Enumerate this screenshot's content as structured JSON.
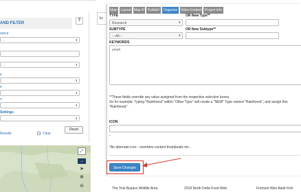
{
  "left_panel": {
    "title": "AND FILTER",
    "help": "?",
    "source_label": "ource",
    "source_value": "...",
    "select2_value": "...",
    "row3_label": "e",
    "row4_label": "e",
    "row5_label": "n",
    "settings_label": "Settings",
    "results_label": "Results",
    "clear_label": "Clear",
    "reset_label": "Reset"
  },
  "modal": {
    "tabs": [
      "Main",
      "Layout",
      "Map It!",
      "Publish!",
      "Organize",
      "Video Embed",
      "Project Info"
    ],
    "active_tab": "Organize",
    "type_label": "TYPE",
    "type_value": "Research",
    "new_type_label": "OR New Type**",
    "subtype_label": "SUBTYPE",
    "subtype_value": "---All---",
    "new_subtype_label": "OR New Subtype**",
    "keywords_label": "KEYWORDS",
    "keywords_value": "smelt",
    "note1": "**These fields override any value assigned from the respective selection boxes.",
    "note2": "So for example: Typing \"Rainforest\" within \"Other Type\" will create a \"NEW\" Type named \"Rainforest\", and assign this",
    "note3": "\"Rainforest\".",
    "icon_label": "ICON",
    "icon_dash": "-",
    "icon_note": "*An alternate icon - overrides content thumbnails etc..",
    "save_label": "Save Changes"
  },
  "background": {
    "back_tab": "Se",
    "card1": "The Yolo Bypass Wildlife Area",
    "card2": "2018 North Delta Food Web",
    "card3": "Fremont Weir Adult Fish"
  },
  "colors": {
    "accent": "#3d86c6",
    "highlight": "#d9342b",
    "tab_inactive": "#8a8a8a"
  }
}
